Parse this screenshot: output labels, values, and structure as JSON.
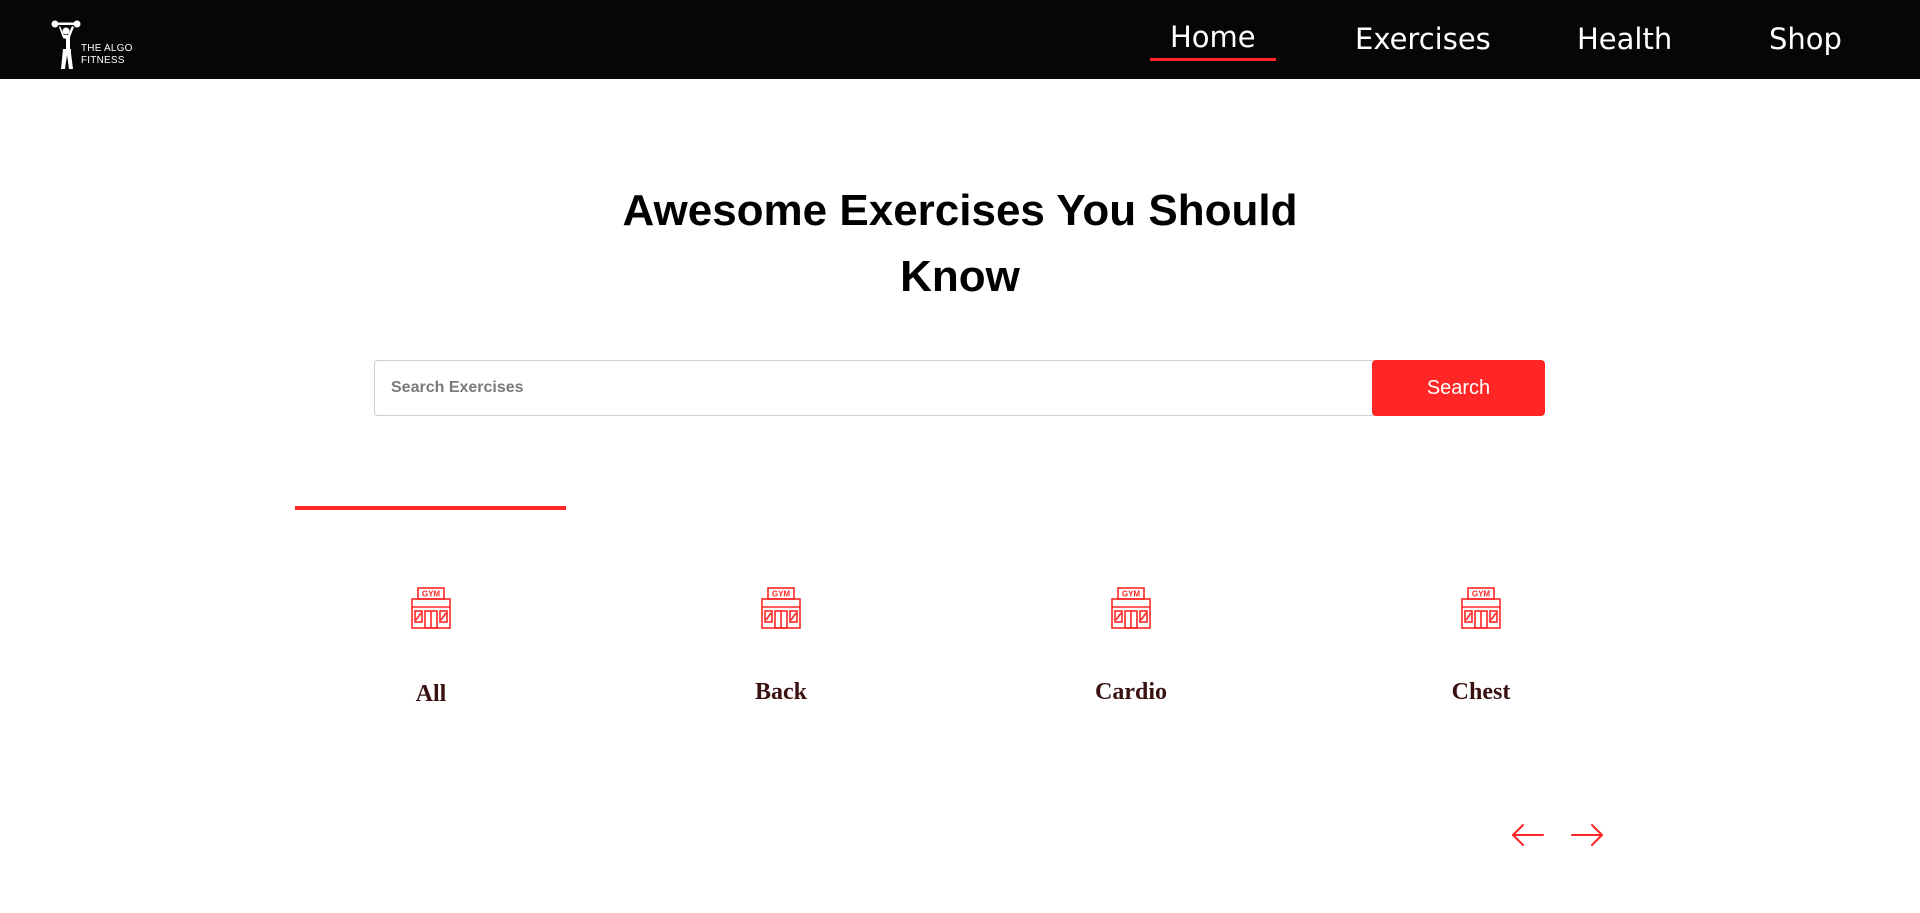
{
  "brand": {
    "name": "THE ALGO\nFITNESS",
    "icon": "weightlifter-icon"
  },
  "nav": {
    "items": [
      {
        "label": "Home",
        "active": true
      },
      {
        "label": "Exercises",
        "active": false
      },
      {
        "label": "Health",
        "active": false
      },
      {
        "label": "Shop",
        "active": false
      }
    ]
  },
  "hero": {
    "title": "Awesome Exercises You Should Know"
  },
  "search": {
    "placeholder": "Search Exercises",
    "value": "",
    "button_label": "Search"
  },
  "categories": {
    "selected": "All",
    "items": [
      {
        "label": "All",
        "icon": "gym-icon"
      },
      {
        "label": "Back",
        "icon": "gym-icon"
      },
      {
        "label": "Cardio",
        "icon": "gym-icon"
      },
      {
        "label": "Chest",
        "icon": "gym-icon"
      }
    ]
  },
  "pagination": {
    "prev_icon": "arrow-left-icon",
    "next_icon": "arrow-right-icon"
  },
  "colors": {
    "accent": "#ff2625",
    "nav_background": "#060606",
    "category_text": "#3a1212",
    "page_background": "#ffffff"
  }
}
